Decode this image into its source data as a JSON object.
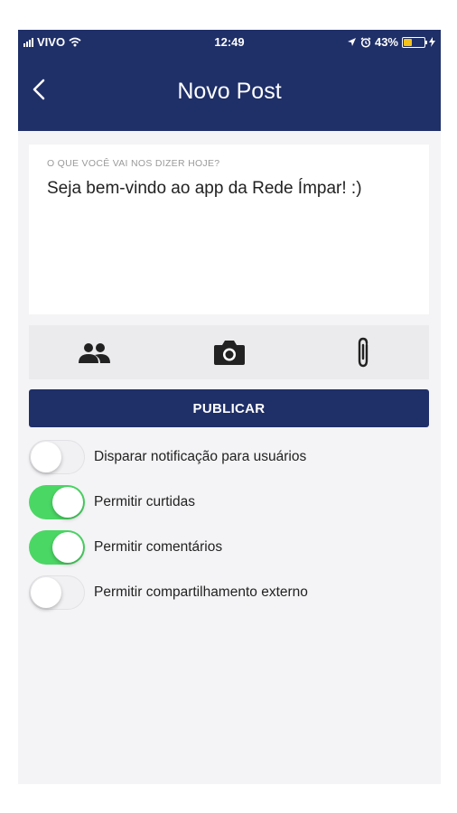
{
  "status_bar": {
    "carrier": "VIVO",
    "time": "12:49",
    "battery": "43%",
    "battery_level": 0.43
  },
  "header": {
    "title": "Novo Post"
  },
  "composer": {
    "placeholder": "O QUE VOCÊ VAI NOS DIZER HOJE?",
    "text": "Seja bem-vindo ao app da Rede Ímpar! :)"
  },
  "toolbar": {
    "icons": [
      "people-icon",
      "camera-icon",
      "paperclip-icon"
    ]
  },
  "publish_label": "PUBLICAR",
  "options": [
    {
      "label": "Disparar notificação para usuários",
      "enabled": false
    },
    {
      "label": "Permitir curtidas",
      "enabled": true
    },
    {
      "label": "Permitir comentários",
      "enabled": true
    },
    {
      "label": "Permitir compartilhamento externo",
      "enabled": false
    }
  ],
  "colors": {
    "primary": "#1f2f68",
    "toggle_on": "#4bd764",
    "battery": "#f4c21b"
  }
}
